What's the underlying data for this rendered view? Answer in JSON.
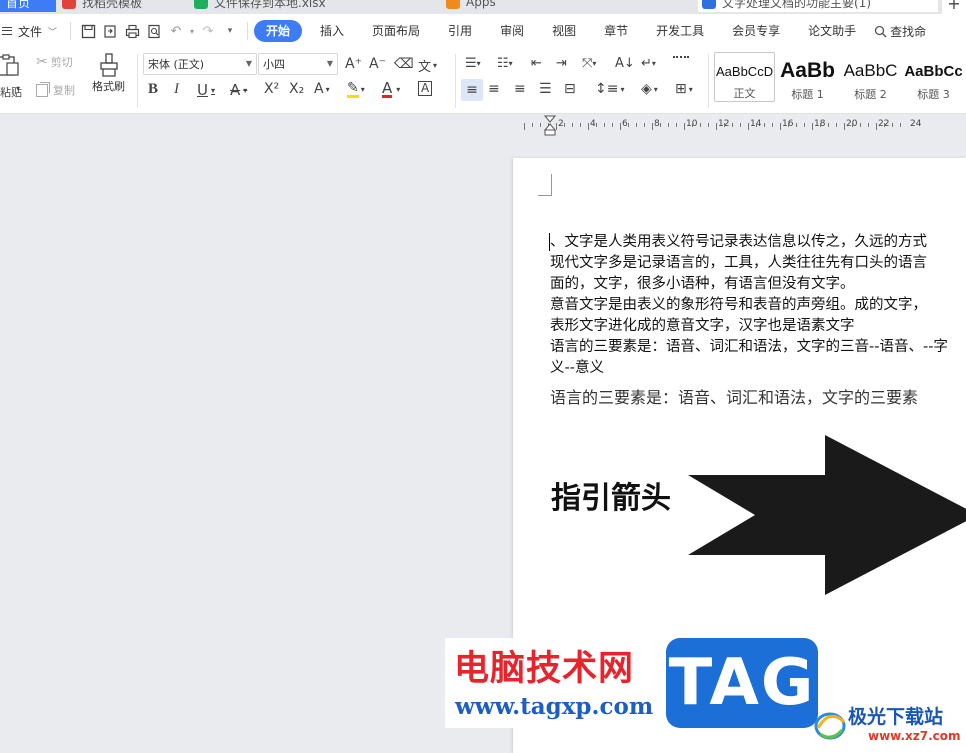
{
  "tabs": [
    {
      "label": "首页",
      "color": "#3d7cf5"
    },
    {
      "label": "找稻壳模板",
      "color": "#e0433a"
    },
    {
      "label": "文件保存到本地.xlsx",
      "color": "#1fae5b"
    },
    {
      "label": "Apps",
      "color": "#f08a1c"
    },
    {
      "label": "文字处理文档的功能主要(1)",
      "color": "#2f6fe0"
    }
  ],
  "menubar": {
    "file_label": "文件",
    "tabs": [
      "开始",
      "插入",
      "页面布局",
      "引用",
      "审阅",
      "视图",
      "章节",
      "开发工具",
      "会员专享",
      "论文助手"
    ],
    "active_tab": "开始",
    "search_label": "查找命"
  },
  "ribbon": {
    "paste_label": "粘贴",
    "cut_label": "剪切",
    "copy_label": "复制",
    "format_painter_label": "格式刷",
    "font_name": "宋体 (正文)",
    "font_size": "小四",
    "styles": [
      {
        "sample": "AaBbCcD",
        "name": "正文"
      },
      {
        "sample": "AaBb",
        "name": "标题 1"
      },
      {
        "sample": "AaBbC",
        "name": "标题 2"
      },
      {
        "sample": "AaBbCc",
        "name": "标题 3"
      }
    ]
  },
  "ruler": {
    "labels": [
      "2",
      "4",
      "6",
      "8",
      "10",
      "12",
      "14",
      "16",
      "18",
      "20",
      "22",
      "24"
    ]
  },
  "document": {
    "lines": [
      "、文字是人类用表义符号记录表达信息以传之，久远的方式",
      "现代文字多是记录语言的，工具，人类往往先有口头的语言",
      "面的，文字，很多小语种，有语言但没有文字。",
      "意音文字是由表义的象形符号和表音的声旁组。成的文字，",
      "表形文字进化成的意音文字，汉字也是语素文字",
      "语言的三要素是：语音、词汇和语法，文字的三音--语音、--字",
      "义--意义"
    ],
    "serif_line": "语言的三要素是：语音、词汇和语法，文字的三要素",
    "arrow_label": "指引箭头"
  },
  "watermark": {
    "site_name": "电脑技术网",
    "site_url": "www.tagxp.com",
    "tag_text": "TAG",
    "jg_name": "极光下载站",
    "jg_url": "www.xz7.com"
  }
}
